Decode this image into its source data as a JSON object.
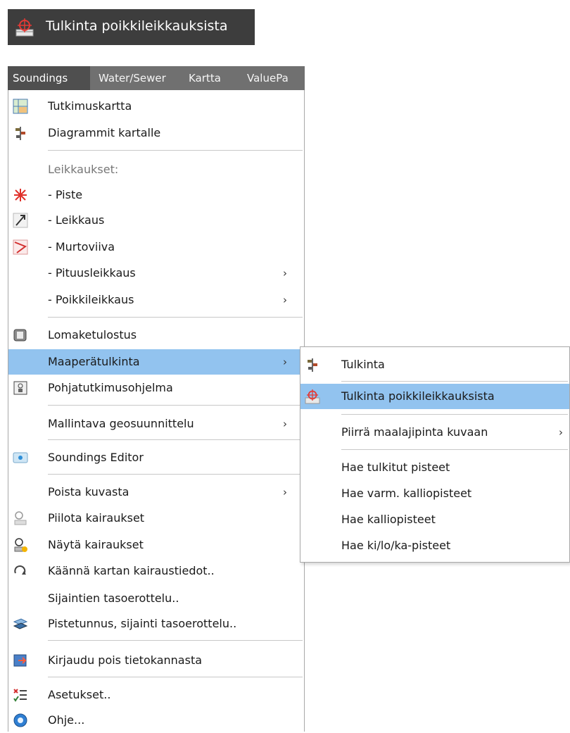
{
  "title_chip": {
    "icon": "crosshair-section-icon",
    "label": "Tulkinta poikkileikkauksista"
  },
  "menubar": {
    "items": [
      "Soundings",
      "Water/Sewer",
      "Kartta",
      "ValuePa"
    ]
  },
  "menu": {
    "items": [
      {
        "label": "Tutkimuskartta",
        "icon": "map-grid-icon"
      },
      {
        "label": "Diagrammit kartalle",
        "icon": "diagram-icon"
      },
      {
        "label": "Leikkaukset:"
      },
      {
        "label": "- Piste",
        "icon": "point-star-icon"
      },
      {
        "label": "- Leikkaus",
        "icon": "section-line-icon"
      },
      {
        "label": "- Murtoviiva",
        "icon": "polyline-icon"
      },
      {
        "label": "- Pituusleikkaus",
        "arrow": "›"
      },
      {
        "label": "- Poikkileikkaus",
        "arrow": "›"
      },
      {
        "label": "Lomaketulostus",
        "icon": "print-form-icon"
      },
      {
        "label": "Maaperätulkinta",
        "arrow": "›"
      },
      {
        "label": "Pohjatutkimusohjelma",
        "icon": "program-icon"
      },
      {
        "label": "Mallintava geosuunnittelu",
        "arrow": "›"
      },
      {
        "label": "Soundings Editor",
        "icon": "editor-icon"
      },
      {
        "label": "Poista kuvasta",
        "arrow": "›"
      },
      {
        "label": "Piilota kairaukset",
        "icon": "hide-soundings-icon"
      },
      {
        "label": "Näytä kairaukset",
        "icon": "show-soundings-icon"
      },
      {
        "label": "Käännä kartan kairaustiedot..",
        "icon": "rotate-icon"
      },
      {
        "label": "Sijaintien tasoerottelu.."
      },
      {
        "label": "Pistetunnus, sijainti tasoerottelu..",
        "icon": "layers-icon"
      },
      {
        "label": "Kirjaudu pois tietokannasta",
        "icon": "logout-db-icon"
      },
      {
        "label": "Asetukset..",
        "icon": "settings-list-icon"
      },
      {
        "label": "Ohje...",
        "icon": "help-icon"
      }
    ]
  },
  "submenu": {
    "items": [
      {
        "label": "Tulkinta",
        "icon": "diagram-icon"
      },
      {
        "label": "Tulkinta poikkileikkauksista",
        "icon": "crosshair-section-icon"
      },
      {
        "label": "Piirrä maalajipinta kuvaan",
        "arrow": "›"
      },
      {
        "label": "Hae tulkitut pisteet"
      },
      {
        "label": "Hae varm. kalliopisteet"
      },
      {
        "label": "Hae kalliopisteet"
      },
      {
        "label": "Hae ki/lo/ka-pisteet"
      }
    ]
  },
  "colors": {
    "highlight": "#92c3ef",
    "menubar": "#707070",
    "title_bg": "#3d3d3d"
  }
}
